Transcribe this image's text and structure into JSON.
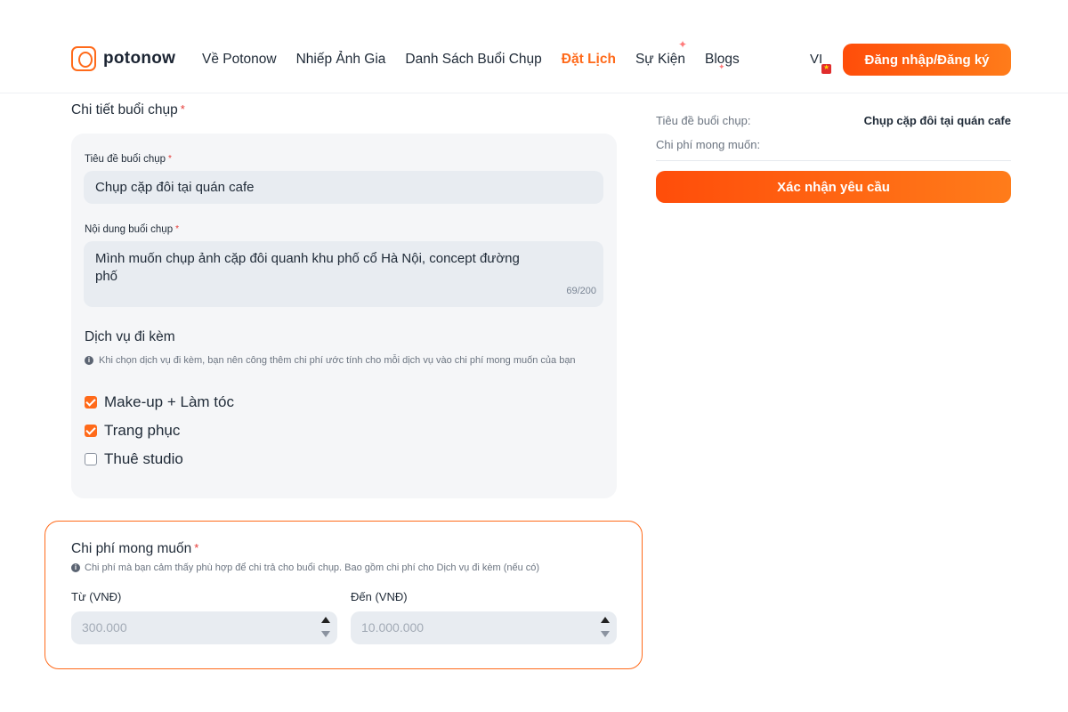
{
  "brand": {
    "name": "potonow",
    "accent": "#ff6a1a"
  },
  "nav": {
    "items": [
      {
        "label": "Về Potonow",
        "active": false
      },
      {
        "label": "Nhiếp Ảnh Gia",
        "active": false
      },
      {
        "label": "Danh Sách Buổi Chụp",
        "active": false
      },
      {
        "label": "Đặt Lịch",
        "active": true
      },
      {
        "label": "Sự Kiện",
        "active": false
      },
      {
        "label": "Blogs",
        "active": false
      }
    ],
    "language": "VI",
    "login_label": "Đăng nhập/Đăng ký"
  },
  "details": {
    "section_title": "Chi tiết buổi chụp",
    "title_label": "Tiêu đề buổi chụp",
    "title_value": "Chụp cặp đôi tại quán cafe",
    "content_label": "Nội dung buổi chụp",
    "content_value": "Mình muốn chụp ảnh cặp đôi quanh khu phố cổ Hà Nội, concept đường phố",
    "content_counter": "69/200",
    "services_title": "Dịch vụ đi kèm",
    "services_hint": "Khi chọn dịch vụ đi kèm, bạn nên công thêm chi phí ước tính cho mỗi dịch vụ vào chi phí mong muốn của bạn",
    "services": [
      {
        "label": "Make-up + Làm tóc",
        "checked": true
      },
      {
        "label": "Trang phục",
        "checked": true
      },
      {
        "label": "Thuê studio",
        "checked": false
      }
    ]
  },
  "cost": {
    "title": "Chi phí mong muốn",
    "hint": "Chi phí mà bạn cảm thấy phù hợp để chi trả cho buổi chụp. Bao gồm chi phí cho Dịch vụ đi kèm (nếu có)",
    "from_label": "Từ (VNĐ)",
    "from_placeholder": "300.000",
    "to_label": "Đến (VNĐ)",
    "to_placeholder": "10.000.000"
  },
  "summary": {
    "title_key": "Tiêu đề buổi chụp:",
    "title_value": "Chụp cặp đôi tại quán cafe",
    "cost_key": "Chi phí mong muốn:",
    "cost_value": "",
    "confirm_label": "Xác nhận yêu cầu"
  },
  "required_mark": "*",
  "icons": {
    "info": "info-icon",
    "checkbox_checked": "checkbox-checked-icon",
    "checkbox_unchecked": "checkbox-unchecked-icon"
  }
}
